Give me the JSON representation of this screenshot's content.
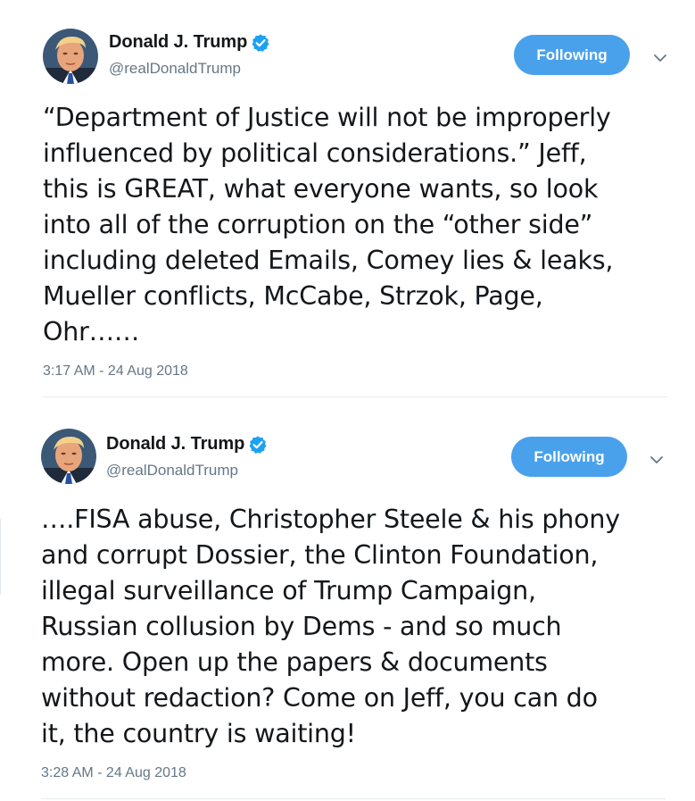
{
  "colors": {
    "follow_button_bg": "#4aa1eb",
    "verified_badge": "#1da1f2",
    "text_primary": "#14171a",
    "text_secondary": "#657786",
    "divider": "#e6ecf0"
  },
  "icons": {
    "verified": "verified-badge-icon",
    "caret": "chevron-down-icon",
    "avatar": "profile-photo"
  },
  "tweets": [
    {
      "author": {
        "display_name": "Donald J. Trump",
        "handle": "@realDonaldTrump",
        "verified": true
      },
      "follow_label": "Following",
      "text": "“Department of Justice will not be improperly\ninfluenced by political considerations.” Jeff,\nthis is GREAT, what everyone wants, so look\ninto all of the corruption on the “other side”\nincluding deleted Emails, Comey lies & leaks,\nMueller conflicts, McCabe, Strzok, Page,\nOhr……",
      "timestamp": "3:17 AM - 24 Aug 2018"
    },
    {
      "author": {
        "display_name": "Donald J. Trump",
        "handle": "@realDonaldTrump",
        "verified": true
      },
      "follow_label": "Following",
      "text": "….FISA abuse, Christopher Steele & his phony\nand corrupt Dossier, the Clinton Foundation,\nillegal surveillance of Trump Campaign,\nRussian collusion by Dems - and so much\nmore. Open up the papers & documents\nwithout redaction? Come on Jeff, you can do\nit, the country is waiting!",
      "timestamp": "3:28 AM - 24 Aug 2018"
    }
  ]
}
